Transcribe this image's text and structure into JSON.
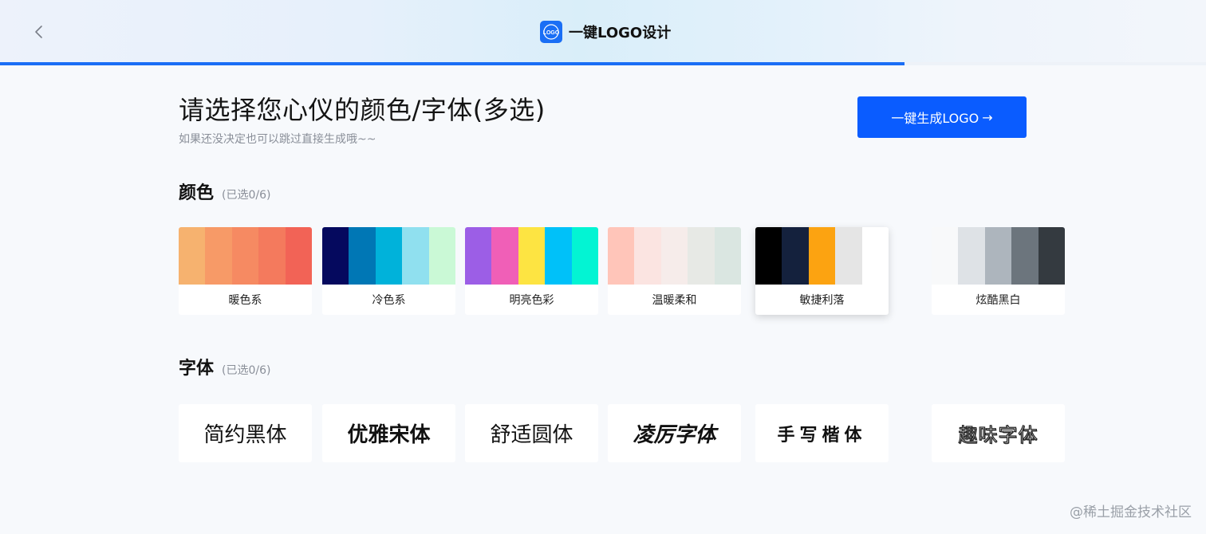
{
  "header": {
    "back_icon": "chevron-left-icon",
    "brand_icon": "logo-icon",
    "brand_icon_text": "LOGO",
    "title": "一键LOGO设计",
    "progress": 0.75
  },
  "main": {
    "title": "请选择您心仪的颜色/字体(多选)",
    "subtitle": "如果还没决定也可以跳过直接生成哦~~",
    "generate_button": "一键生成LOGO",
    "generate_arrow": "→"
  },
  "colors": {
    "section_title": "颜色",
    "count": "(已选0/6)",
    "items": [
      {
        "label": "暖色系",
        "swatches": [
          "#f6b26f",
          "#f79a67",
          "#f68a62",
          "#f47a5d",
          "#f26356"
        ]
      },
      {
        "label": "冷色系",
        "swatches": [
          "#05095e",
          "#0077b5",
          "#00b2da",
          "#90e0ef",
          "#caf9d6"
        ]
      },
      {
        "label": "明亮色彩",
        "swatches": [
          "#9c5ee6",
          "#f05fb7",
          "#fde442",
          "#00c1f9",
          "#03f4d3"
        ]
      },
      {
        "label": "温暖柔和",
        "swatches": [
          "#ffc5b9",
          "#fbe4e1",
          "#f6ecea",
          "#e7e9e5",
          "#dae6e1"
        ]
      },
      {
        "label": "敏捷利落",
        "swatches": [
          "#000000",
          "#14213d",
          "#fca311",
          "#e5e5e5",
          "#ffffff"
        ]
      },
      {
        "label": "炫酷黑白",
        "swatches": [
          "#f8f9fa",
          "#dee2e6",
          "#adb5bd",
          "#6c757d",
          "#343a40"
        ]
      }
    ],
    "selected_index": 4
  },
  "fonts": {
    "section_title": "字体",
    "count": "(已选0/6)",
    "items": [
      {
        "label": "简约黑体"
      },
      {
        "label": "优雅宋体"
      },
      {
        "label": "舒适圆体"
      },
      {
        "label": "凌厉字体"
      },
      {
        "label": "手写楷体"
      },
      {
        "label": "趣味字体"
      }
    ]
  },
  "watermark": "@稀土掘金技术社区",
  "colors_theme": {
    "accent": "#0a5cff",
    "background": "#f7f9fc"
  }
}
